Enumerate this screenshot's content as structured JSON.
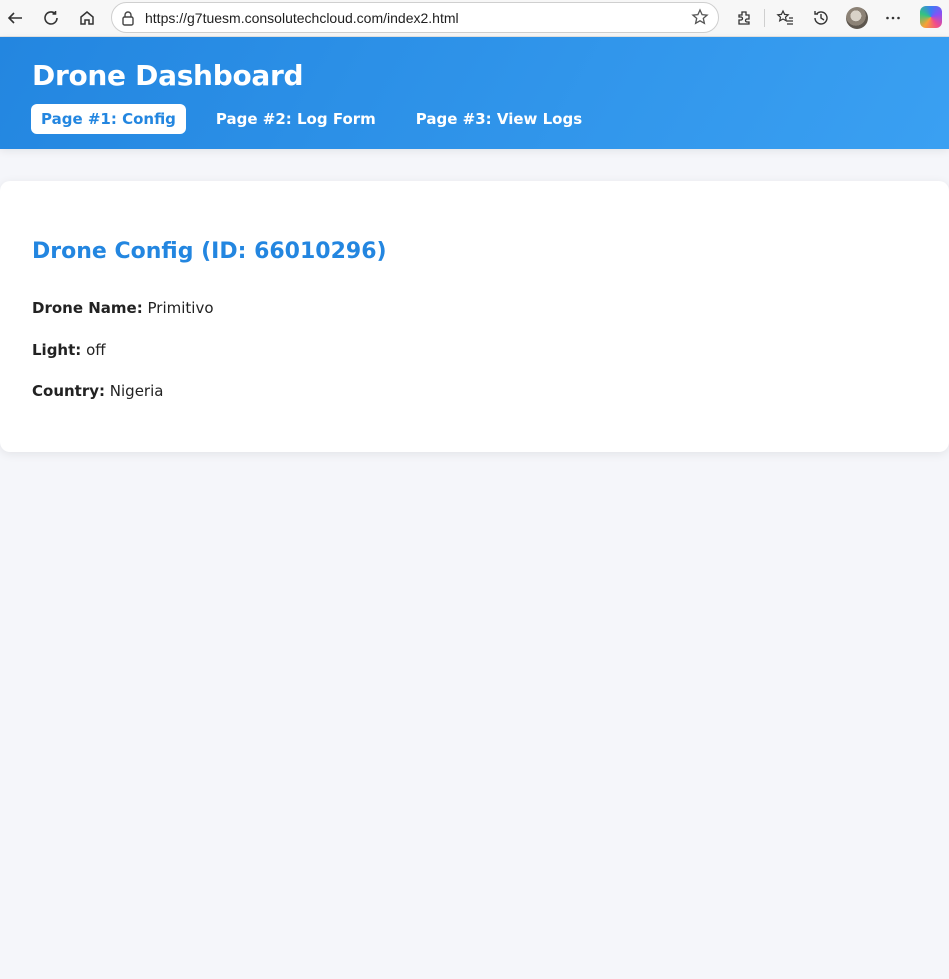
{
  "browser": {
    "url": "https://g7tuesm.consolutechcloud.com/index2.html"
  },
  "app": {
    "title": "Drone Dashboard",
    "tabs": [
      {
        "label": "Page #1: Config",
        "active": true
      },
      {
        "label": "Page #2: Log Form",
        "active": false
      },
      {
        "label": "Page #3: View Logs",
        "active": false
      }
    ]
  },
  "config": {
    "title": "Drone Config (ID: 66010296)",
    "fields": [
      {
        "label": "Drone Name:",
        "value": "Primitivo"
      },
      {
        "label": "Light:",
        "value": "off"
      },
      {
        "label": "Country:",
        "value": "Nigeria"
      }
    ]
  },
  "colors": {
    "accent": "#2386e0",
    "header_gradient_end": "#3aa0f2",
    "page_bg": "#f5f6fa"
  }
}
